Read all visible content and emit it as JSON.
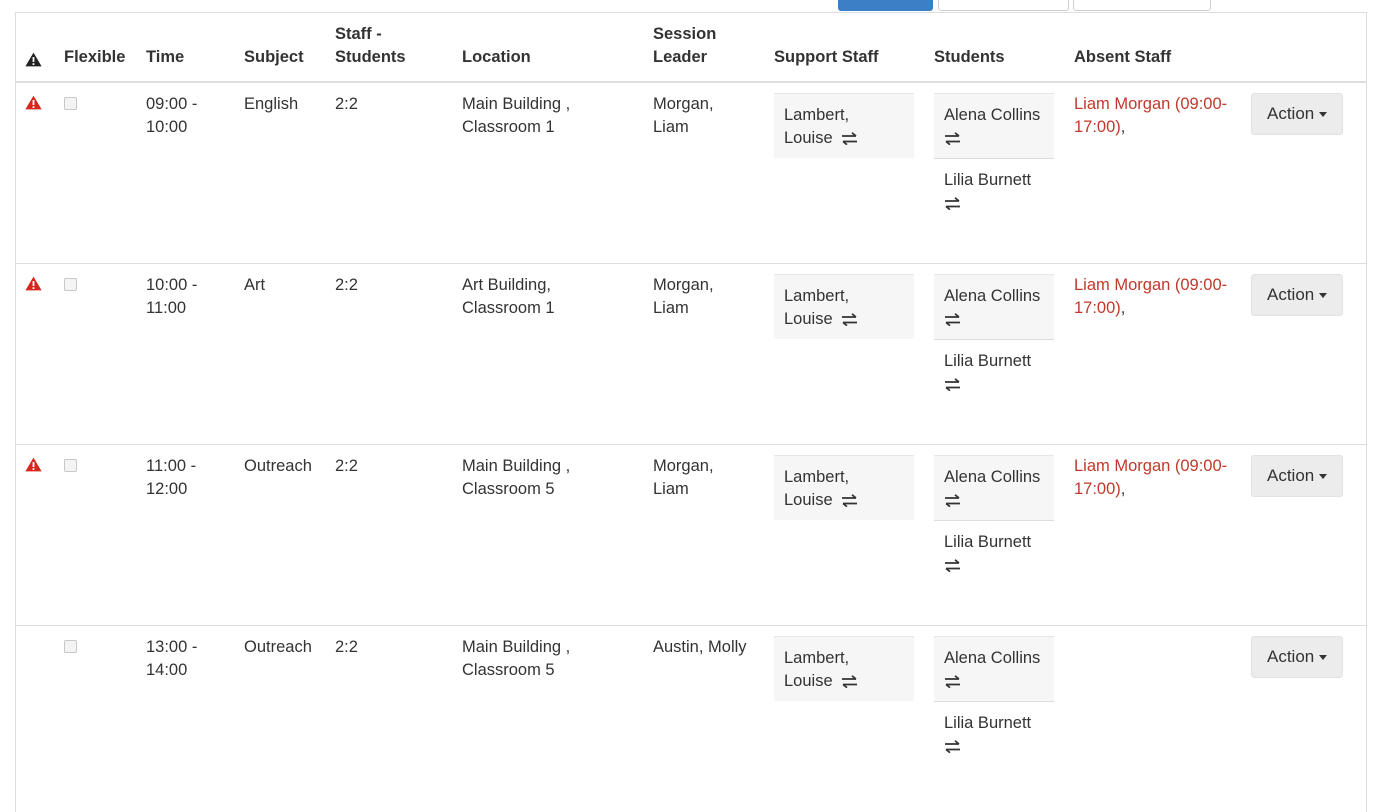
{
  "header": {
    "warning_icon": "warning-icon",
    "flexible": "Flexible",
    "time": "Time",
    "subject": "Subject",
    "staff_students_line1": "Staff -",
    "staff_students_line2": "Students",
    "location": "Location",
    "session_leader_line1": "Session",
    "session_leader_line2": "Leader",
    "support_staff": "Support Staff",
    "students": "Students",
    "absent_staff": "Absent Staff"
  },
  "action_label": "Action",
  "rows": [
    {
      "warning": true,
      "time_start": "09:00 -",
      "time_end": "10:00",
      "subject": "English",
      "ratio": "2:2",
      "location_line1": "Main Building ,",
      "location_line2": "Classroom 1",
      "leader_line1": "Morgan,",
      "leader_line2": "Liam",
      "support_line1": "Lambert,",
      "support_line2": "Louise",
      "student1": "Alena Collins",
      "student2": "Lilia Burnett",
      "absent": "Liam Morgan (09:00-17:00)",
      "absent_suffix": ","
    },
    {
      "warning": true,
      "time_start": "10:00 -",
      "time_end": "11:00",
      "subject": "Art",
      "ratio": "2:2",
      "location_line1": "Art Building,",
      "location_line2": "Classroom 1",
      "leader_line1": "Morgan,",
      "leader_line2": "Liam",
      "support_line1": "Lambert,",
      "support_line2": "Louise",
      "student1": "Alena Collins",
      "student2": "Lilia Burnett",
      "absent": "Liam Morgan (09:00-17:00)",
      "absent_suffix": ","
    },
    {
      "warning": true,
      "time_start": "11:00 -",
      "time_end": "12:00",
      "subject": "Outreach",
      "ratio": "2:2",
      "location_line1": "Main Building ,",
      "location_line2": "Classroom 5",
      "leader_line1": "Morgan,",
      "leader_line2": "Liam",
      "support_line1": "Lambert,",
      "support_line2": "Louise",
      "student1": "Alena Collins",
      "student2": "Lilia Burnett",
      "absent": "Liam Morgan (09:00-17:00)",
      "absent_suffix": ","
    },
    {
      "warning": false,
      "time_start": "13:00 -",
      "time_end": "14:00",
      "subject": "Outreach",
      "ratio": "2:2",
      "location_line1": "Main Building ,",
      "location_line2": "Classroom 5",
      "leader_line1": "Austin, Molly",
      "leader_line2": "",
      "support_line1": "Lambert,",
      "support_line2": "Louise",
      "student1": "Alena Collins",
      "student2": "Lilia Burnett",
      "absent": "",
      "absent_suffix": ""
    }
  ],
  "colors": {
    "warning": "#d9261c",
    "absent_text": "#c0392b",
    "button_bg": "#ececec",
    "primary_tab": "#3c7fc7"
  }
}
